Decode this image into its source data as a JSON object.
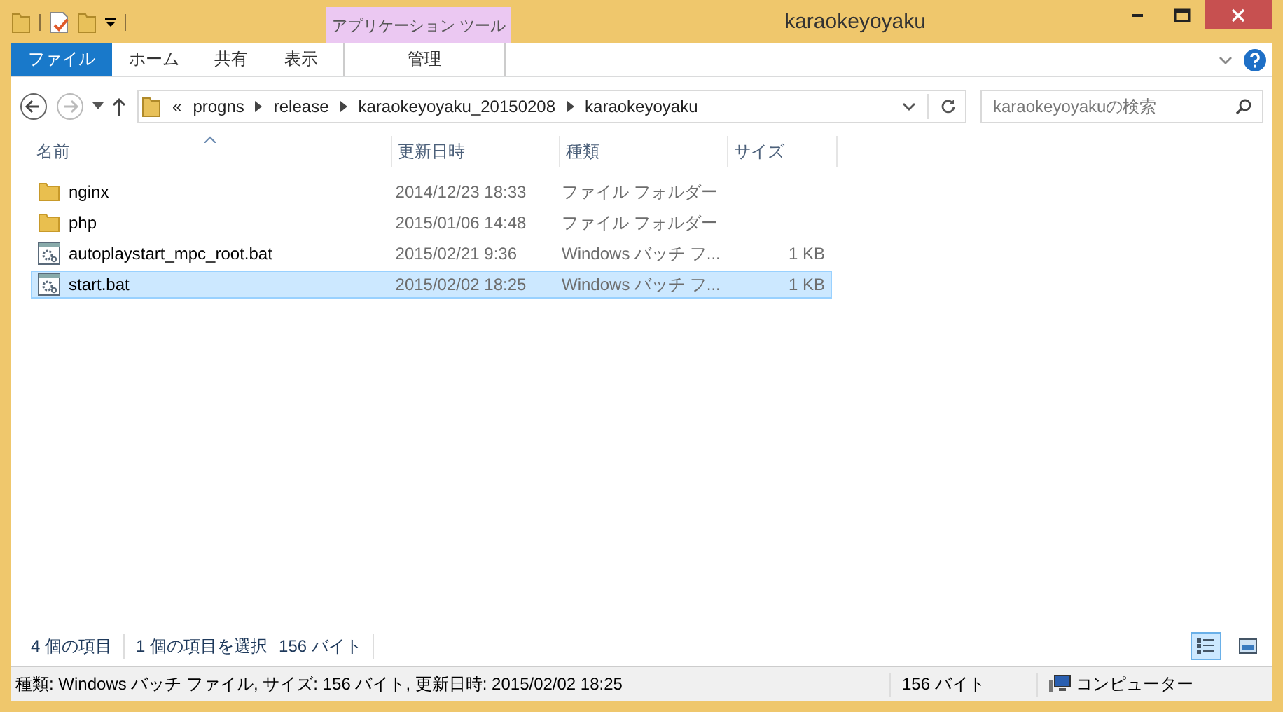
{
  "window": {
    "title": "karaokeyoyaku"
  },
  "contextual_group": {
    "label": "アプリケーション ツール"
  },
  "ribbon_tabs": [
    {
      "label": "ファイル",
      "kind": "file",
      "selected": false
    },
    {
      "label": "ホーム",
      "kind": "normal",
      "selected": false
    },
    {
      "label": "共有",
      "kind": "normal",
      "selected": false
    },
    {
      "label": "表示",
      "kind": "normal",
      "selected": false
    },
    {
      "label": "管理",
      "kind": "contextual",
      "selected": false
    }
  ],
  "address": {
    "overflow": "«",
    "path": [
      "progns",
      "release",
      "karaokeyoyaku_20150208",
      "karaokeyoyaku"
    ]
  },
  "search": {
    "placeholder": "karaokeyoyakuの検索"
  },
  "columns": [
    {
      "label": "名前",
      "sorted": true
    },
    {
      "label": "更新日時",
      "sorted": false
    },
    {
      "label": "種類",
      "sorted": false
    },
    {
      "label": "サイズ",
      "sorted": false
    }
  ],
  "rows": [
    {
      "kind": "folder",
      "name": "nginx",
      "date": "2014/12/23 18:33",
      "type": "ファイル フォルダー",
      "selected": false
    },
    {
      "kind": "folder",
      "name": "php",
      "date": "2015/01/06 14:48",
      "type": "ファイル フォルダー",
      "selected": false
    },
    {
      "kind": "batch",
      "name": "autoplaystart_mpc_root.bat",
      "date": "2015/02/21 9:36",
      "type": "Windows バッチ フ...",
      "size": "1 KB",
      "selected": false
    },
    {
      "kind": "batch",
      "name": "start.bat",
      "date": "2015/02/02 18:25",
      "type": "Windows バッチ フ...",
      "size": "1 KB",
      "selected": true
    }
  ],
  "status_bar": {
    "item_count": "4 個の項目",
    "selection": "1 個の項目を選択",
    "selection_size": "156 バイト",
    "views": [
      {
        "kind": "details",
        "selected": true
      },
      {
        "kind": "large-icons",
        "selected": false
      }
    ]
  },
  "details_bar": {
    "summary": "種類: Windows バッチ ファイル, サイズ: 156 バイト, 更新日時: 2015/02/02 18:25",
    "size": "156 バイト",
    "location": "コンピューター"
  }
}
